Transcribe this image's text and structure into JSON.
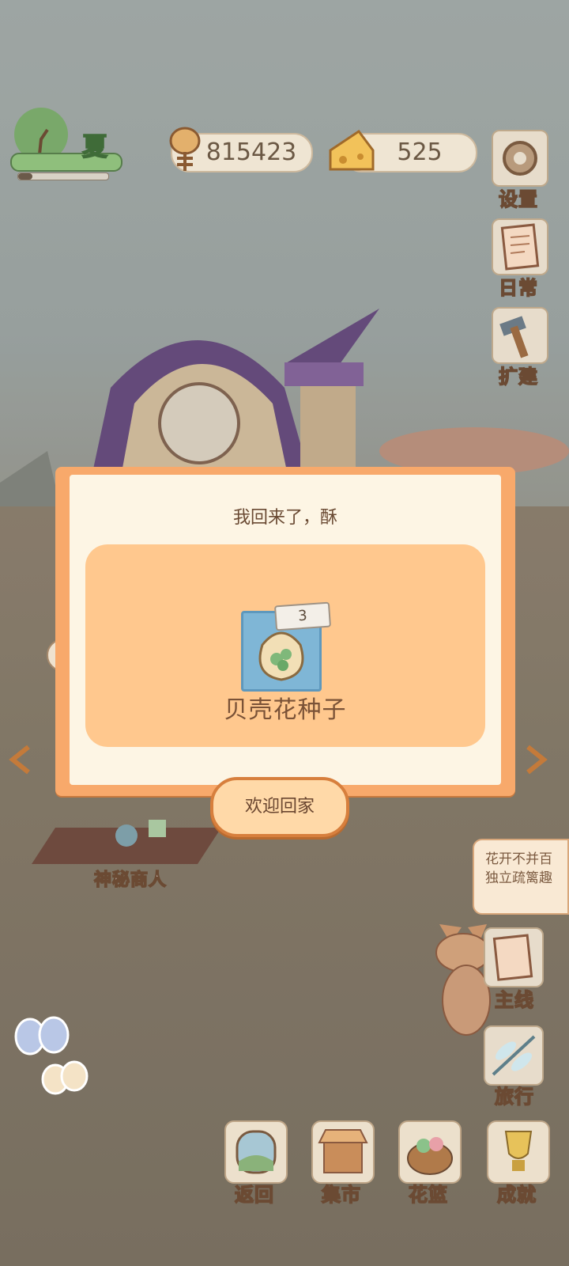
{
  "season": {
    "label": "夏"
  },
  "currencies": {
    "fish": "815423",
    "cheese": "525"
  },
  "side_menu": {
    "settings": "设置",
    "daily": "日常",
    "expand": "扩建"
  },
  "dialog": {
    "title": "我回来了，酥",
    "reward": {
      "name": "贝壳花种子",
      "count": "3"
    },
    "button": "欢迎回家"
  },
  "merchant": {
    "label": "神秘商人"
  },
  "notice": {
    "line1": "花开不并百",
    "line2": "独立疏篱趣"
  },
  "right_menu": {
    "main_quest": "主线",
    "travel": "旅行"
  },
  "bottom_nav": {
    "back": "返回",
    "market": "集市",
    "basket": "花篮",
    "achievements": "成就"
  }
}
